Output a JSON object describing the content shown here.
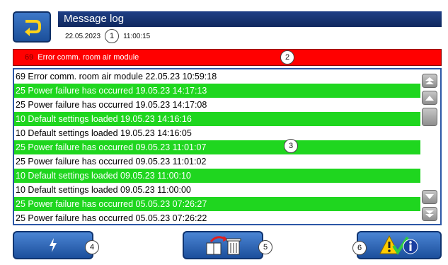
{
  "header": {
    "title": "Message log",
    "date": "22.05.2023",
    "time": "11:00:15"
  },
  "active_error": {
    "code": "69",
    "text": "Error comm. room air module"
  },
  "callouts": [
    "1",
    "2",
    "3",
    "4",
    "5",
    "6"
  ],
  "log": [
    {
      "text": "69 Error comm. room air module 22.05.23 10:59:18",
      "color": "white"
    },
    {
      "text": "25 Power failure has occurred 19.05.23 14:17:13",
      "color": "green"
    },
    {
      "text": "25 Power failure has occurred 19.05.23 14:17:08",
      "color": "white"
    },
    {
      "text": "10 Default settings loaded 19.05.23 14:16:16",
      "color": "green"
    },
    {
      "text": "10 Default settings loaded 19.05.23 14:16:05",
      "color": "white"
    },
    {
      "text": "25 Power failure has occurred 09.05.23 11:01:07",
      "color": "green"
    },
    {
      "text": "25 Power failure has occurred 09.05.23 11:01:02",
      "color": "white"
    },
    {
      "text": "10 Default settings loaded 09.05.23 11:00:10",
      "color": "green"
    },
    {
      "text": "10 Default settings loaded 09.05.23 11:00:00",
      "color": "white"
    },
    {
      "text": "25 Power failure has occurred 05.05.23 07:26:27",
      "color": "green"
    },
    {
      "text": "25 Power failure has occurred 05.05.23 07:26:22",
      "color": "white"
    }
  ],
  "icons": {
    "back": "back-arrow-icon",
    "left": "lightning-icon",
    "middle": "export-trash-icon",
    "right": "warning-info-icon"
  },
  "colors": {
    "green": "#1fd61f",
    "red": "#ff0000",
    "blue": "#1c4f9c"
  }
}
